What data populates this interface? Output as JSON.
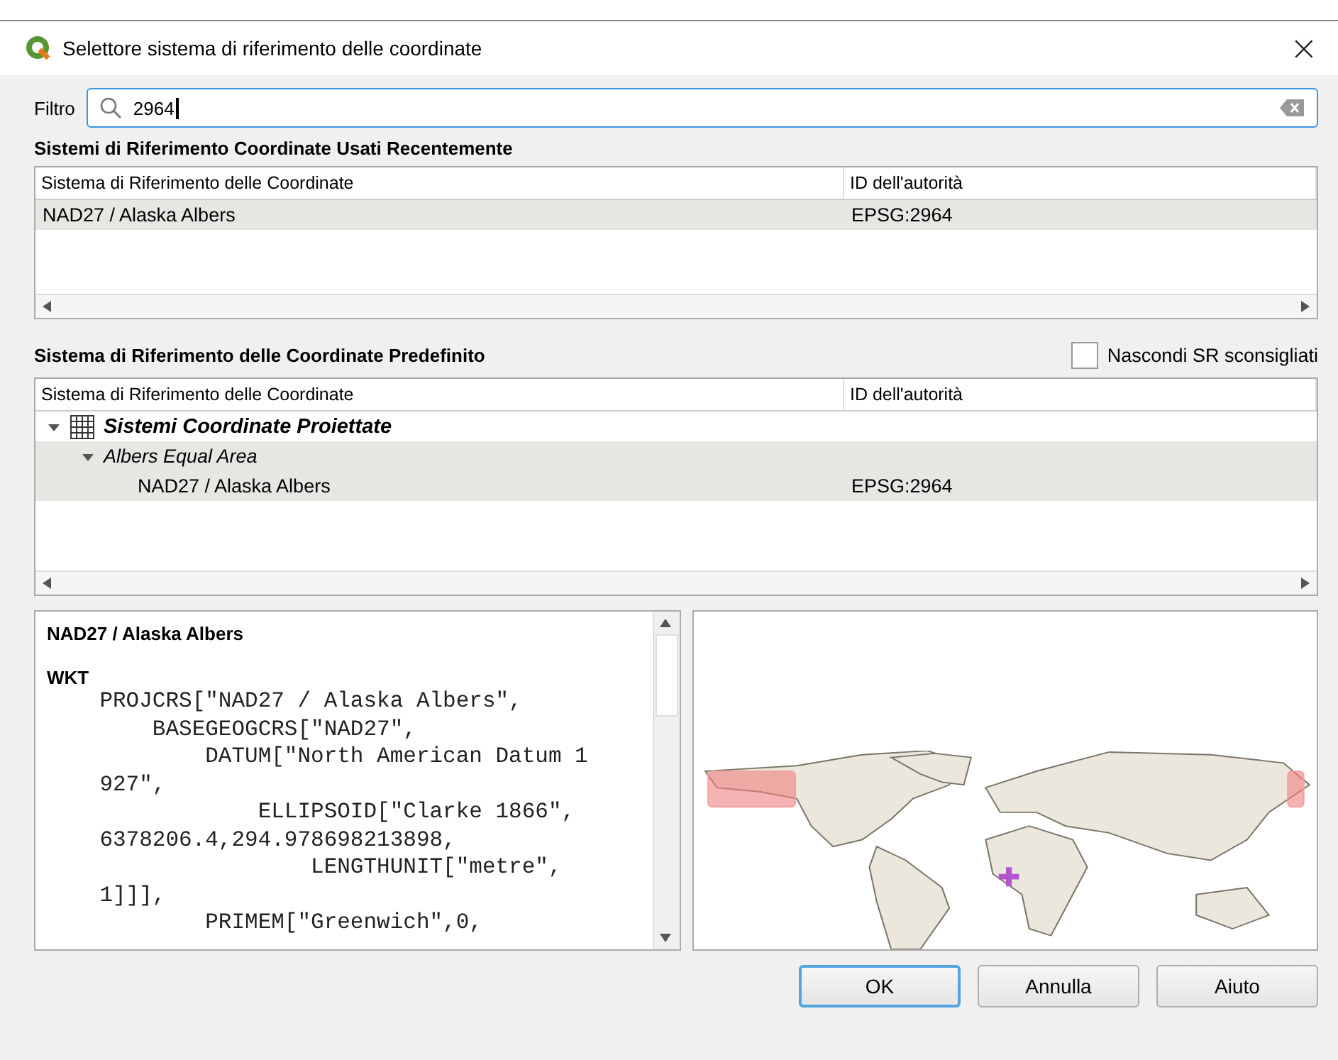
{
  "window": {
    "title": "Selettore sistema di riferimento delle coordinate",
    "close": "×"
  },
  "filter": {
    "label": "Filtro",
    "value": "2964"
  },
  "recent": {
    "heading": "Sistemi di Riferimento Coordinate Usati Recentemente",
    "columns": [
      "Sistema di Riferimento delle Coordinate",
      "ID dell'autorità"
    ],
    "rows": [
      {
        "name": "NAD27 / Alaska Albers",
        "id": "EPSG:2964",
        "selected": true
      }
    ]
  },
  "predefined": {
    "heading": "Sistema di Riferimento delle Coordinate Predefinito",
    "hide_deprecated": {
      "label": "Nascondi SR sconsigliati",
      "checked": false
    },
    "columns": [
      "Sistema di Riferimento delle Coordinate",
      "ID dell'autorità"
    ],
    "tree": [
      {
        "name": "Sistemi Coordinate Proiettate",
        "kind": "group",
        "expanded": true,
        "selected": false,
        "children": [
          {
            "name": "Albers Equal Area",
            "kind": "projection",
            "expanded": true,
            "selected": true,
            "children": [
              {
                "name": "NAD27 / Alaska Albers",
                "kind": "crs",
                "id": "EPSG:2964",
                "selected": true
              }
            ]
          }
        ]
      }
    ]
  },
  "details": {
    "title": "NAD27 / Alaska Albers",
    "section": "WKT",
    "wkt_lines": [
      "    PROJCRS[\"NAD27 / Alaska Albers\",",
      "        BASEGEOGCRS[\"NAD27\",",
      "            DATUM[\"North American Datum 1",
      "    927\",",
      "                ELLIPSOID[\"Clarke 1866\",",
      "    6378206.4,294.978698213898,",
      "                    LENGTHUNIT[\"metre\",",
      "    1]]],",
      "            PRIMEM[\"Greenwich\",0,"
    ]
  },
  "buttons": [
    {
      "label": "OK",
      "default": true
    },
    {
      "label": "Annulla",
      "default": false
    },
    {
      "label": "Aiuto",
      "default": false
    }
  ]
}
